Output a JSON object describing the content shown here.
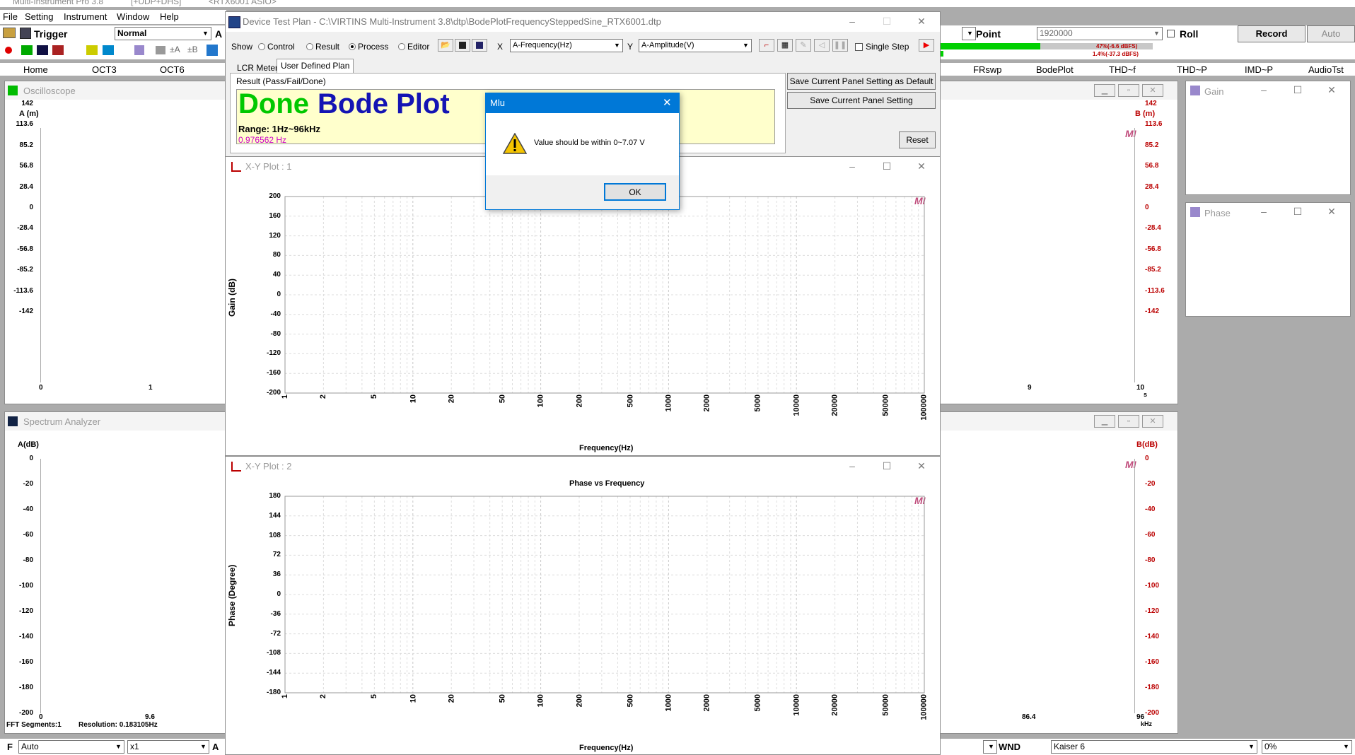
{
  "app": {
    "title": "Multi-Instrument Pro 3.8",
    "tag1": "[+UDP+DHS]",
    "tag2": "<RTX6001 ASIO>"
  },
  "menu": [
    "File",
    "Setting",
    "Instrument",
    "Window",
    "Help"
  ],
  "toolbar": {
    "trigger_label": "Trigger",
    "trigger_mode": "Normal",
    "a_label": "A",
    "point_label": "Point",
    "point_value": "1920000",
    "roll_label": "Roll",
    "record_label": "Record",
    "auto_label": "Auto",
    "meter_top": "47%(-6.6 dBFS)",
    "meter_bottom": "1.4%(-37.3 dBFS)",
    "meter_top_fraction": 0.47,
    "meter_bottom_fraction": 0.014
  },
  "main_tabs_left": [
    "Home",
    "OCT3",
    "OCT6"
  ],
  "main_tabs_right": [
    "FRswp",
    "BodePlot",
    "THD~f",
    "THD~P",
    "IMD~P",
    "AudioTst"
  ],
  "oscilloscope": {
    "title": "Oscilloscope",
    "left_unit": "A (m)",
    "right_unit": "B (m)",
    "left_ticks": [
      "142",
      "113.6",
      "85.2",
      "56.8",
      "28.4",
      "0",
      "-28.4",
      "-56.8",
      "-85.2",
      "-113.6",
      "-142"
    ],
    "right_ticks": [
      "142",
      "113.6",
      "85.2",
      "56.8",
      "28.4",
      "0",
      "-28.4",
      "-56.8",
      "-85.2",
      "-113.6",
      "-142"
    ],
    "x_ticks_left": [
      "0",
      "1"
    ],
    "x_ticks_right": [
      "9",
      "10"
    ],
    "x_unit": "s"
  },
  "spectrum": {
    "title": "Spectrum Analyzer",
    "left_unit": "A(dB)",
    "right_unit": "B(dB)",
    "left_ticks": [
      "0",
      "-20",
      "-40",
      "-60",
      "-80",
      "-100",
      "-120",
      "-140",
      "-160",
      "-180",
      "-200"
    ],
    "right_ticks": [
      "0",
      "-20",
      "-40",
      "-60",
      "-80",
      "-100",
      "-120",
      "-140",
      "-160",
      "-180",
      "-200"
    ],
    "x_ticks_left": [
      "0",
      "9.6"
    ],
    "x_ticks_right": [
      "86.4",
      "96"
    ],
    "x_unit": "kHz",
    "fft_segments": "FFT Segments:1",
    "resolution": "Resolution: 0.183105Hz"
  },
  "gain_panel": {
    "title": "Gain"
  },
  "phase_panel": {
    "title": "Phase"
  },
  "bottom_bar": {
    "f_label": "F",
    "f_value": "Auto",
    "mult_value": "x1",
    "a_label": "A",
    "wnd_label": "WND",
    "window_value": "Kaiser 6",
    "overlap_value": "0%"
  },
  "dtp": {
    "title": "Device Test Plan - C:\\VIRTINS Multi-Instrument 3.8\\dtp\\BodePlotFrequencySteppedSine_RTX6001.dtp",
    "show_label": "Show",
    "show_options": [
      "Control",
      "Result",
      "Process",
      "Editor"
    ],
    "show_selected": "Process",
    "x_label": "X",
    "x_value": "A-Frequency(Hz)",
    "y_label": "Y",
    "y_value": "A-Amplitude(V)",
    "single_step_label": "Single Step",
    "tabs": [
      "LCR Meter",
      "User Defined Plan"
    ],
    "result_group": "Result (Pass/Fail/Done)",
    "result_done": "Done",
    "result_name": "Bode Plot",
    "range_text": "Range: 1Hz~96kHz",
    "partial_text": "0.976562 Hz",
    "save_default_btn": "Save Current Panel Setting as Default",
    "save_btn": "Save Current Panel Setting",
    "reset_btn": "Reset"
  },
  "xy1": {
    "title": "X-Y Plot : 1",
    "ylabel": "Gain (dB)",
    "xlabel": "Frequency(Hz)",
    "y_ticks": [
      "200",
      "160",
      "120",
      "80",
      "40",
      "0",
      "-40",
      "-80",
      "-120",
      "-160",
      "-200"
    ],
    "x_ticks": [
      "1",
      "2",
      "5",
      "10",
      "20",
      "50",
      "100",
      "200",
      "500",
      "1000",
      "2000",
      "5000",
      "10000",
      "20000",
      "50000",
      "100000"
    ]
  },
  "xy2": {
    "title": "X-Y Plot : 2",
    "plot_title": "Phase vs Frequency",
    "ylabel": "Phase (Degree)",
    "xlabel": "Frequency(Hz)",
    "y_ticks": [
      "180",
      "144",
      "108",
      "72",
      "36",
      "0",
      "-36",
      "-72",
      "-108",
      "-144",
      "-180"
    ],
    "x_ticks": [
      "1",
      "2",
      "5",
      "10",
      "20",
      "50",
      "100",
      "200",
      "500",
      "1000",
      "2000",
      "5000",
      "10000",
      "20000",
      "50000",
      "100000"
    ]
  },
  "dialog": {
    "title": "Mlu",
    "message": "Value should be within 0~7.07 V",
    "ok_label": "OK"
  },
  "watermark": "MI",
  "colors": {
    "done_green": "#00c800",
    "bode_blue": "#1414b4",
    "result_bg": "#ffffcc",
    "meter_green": "#00d000",
    "dialog_blue": "#0078d7",
    "right_axis_red": "#b00000"
  }
}
